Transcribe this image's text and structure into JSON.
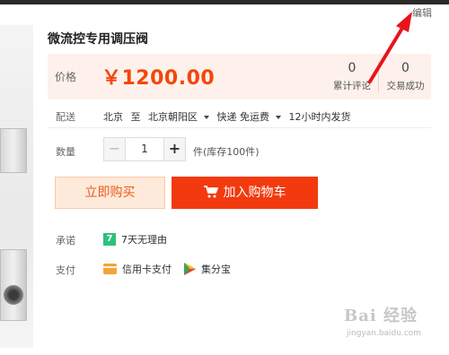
{
  "header": {
    "edit_label": "编辑"
  },
  "product": {
    "title": "微流控专用调压阀"
  },
  "price": {
    "label": "价格",
    "value": "￥1200.00"
  },
  "stats": {
    "reviews": {
      "count": "0",
      "label": "累计评论"
    },
    "trades": {
      "count": "0",
      "label": "交易成功"
    }
  },
  "delivery": {
    "label": "配送",
    "from": "北京",
    "to_prefix": "至",
    "to": "北京朝阳区",
    "method": "快递 免运费",
    "ship_time": "12小时内发货"
  },
  "quantity": {
    "label": "数量",
    "minus": "−",
    "value": "1",
    "plus": "+",
    "stock_text": "件(库存100件)"
  },
  "actions": {
    "buy_now": "立即购买",
    "add_to_cart": "加入购物车"
  },
  "promise": {
    "label": "承诺",
    "badge": "7",
    "text": "7天无理由"
  },
  "payment": {
    "label": "支付",
    "credit_card": "信用卡支付",
    "jifenbao": "集分宝"
  },
  "watermark": {
    "main": "Bai 经验",
    "sub": "jingyan.baidu.com"
  },
  "colors": {
    "accent": "#f2470c",
    "cart_button": "#f23a0e",
    "price_bg": "#fef1eb",
    "arrow": "#e8141c"
  }
}
